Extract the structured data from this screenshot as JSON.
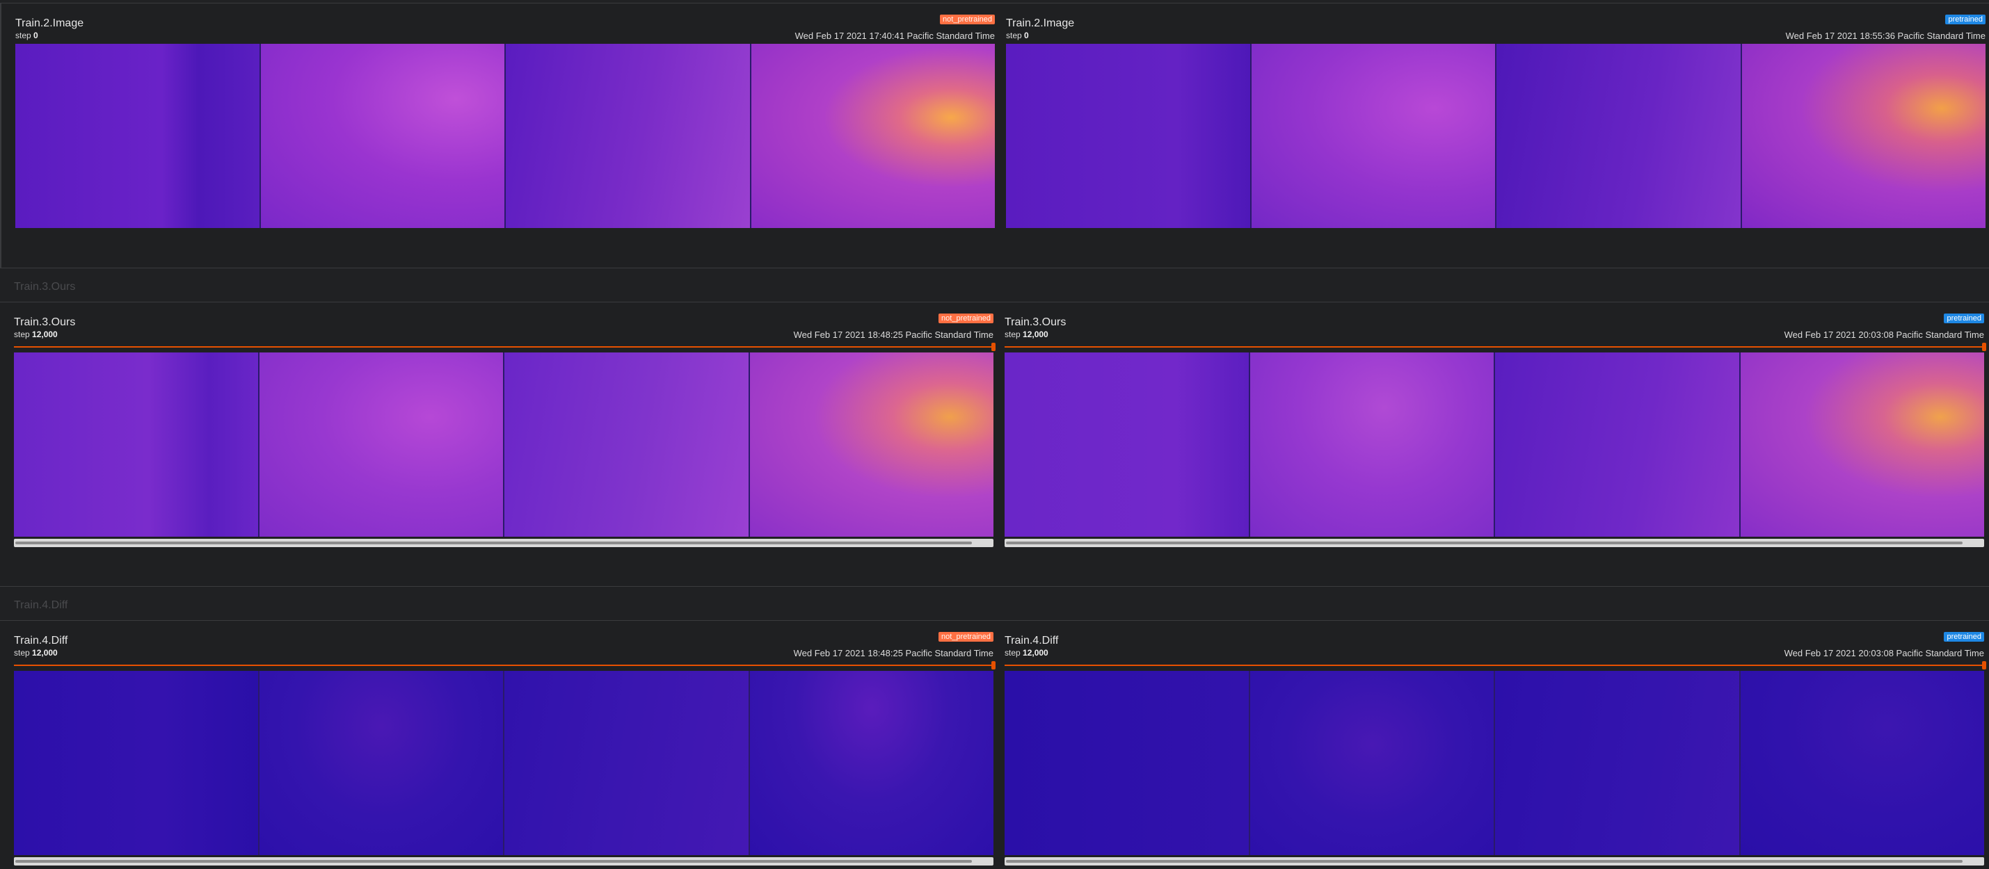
{
  "groups": [
    {
      "title": "Train.3.Ours"
    },
    {
      "title": "Train.4.Diff"
    }
  ],
  "sections": [
    {
      "cards": [
        {
          "title": "Train.2.Image",
          "step_label": "step",
          "step_value": "0",
          "badge": "not_pretrained",
          "badge_color": "#ff7043",
          "timestamp": "Wed Feb 17 2021 17:40:41 Pacific Standard Time",
          "palette": "image_a"
        },
        {
          "title": "Train.2.Image",
          "step_label": "step",
          "step_value": "0",
          "badge": "pretrained",
          "badge_color": "#1e88e5",
          "timestamp": "Wed Feb 17 2021 18:55:36 Pacific Standard Time",
          "palette": "image_b"
        }
      ]
    },
    {
      "cards": [
        {
          "title": "Train.3.Ours",
          "step_label": "step",
          "step_value": "12,000",
          "badge": "not_pretrained",
          "badge_color": "#ff7043",
          "timestamp": "Wed Feb 17 2021 18:48:25 Pacific Standard Time",
          "palette": "ours_a"
        },
        {
          "title": "Train.3.Ours",
          "step_label": "step",
          "step_value": "12,000",
          "badge": "pretrained",
          "badge_color": "#1e88e5",
          "timestamp": "Wed Feb 17 2021 20:03:08 Pacific Standard Time",
          "palette": "ours_b"
        }
      ]
    },
    {
      "cards": [
        {
          "title": "Train.4.Diff",
          "step_label": "step",
          "step_value": "12,000",
          "badge": "not_pretrained",
          "badge_color": "#ff7043",
          "timestamp": "Wed Feb 17 2021 18:48:25 Pacific Standard Time",
          "palette": "diff_a"
        },
        {
          "title": "Train.4.Diff",
          "step_label": "step",
          "step_value": "12,000",
          "badge": "pretrained",
          "badge_color": "#1e88e5",
          "timestamp": "Wed Feb 17 2021 20:03:08 Pacific Standard Time",
          "palette": "diff_b"
        }
      ]
    }
  ],
  "colors": {
    "slider": "#e65100",
    "depth_dark": "#4a14b0",
    "depth_mid": "#9b2ad0",
    "depth_hot": "#f5a340",
    "diff_base": "#2a0fa8"
  }
}
